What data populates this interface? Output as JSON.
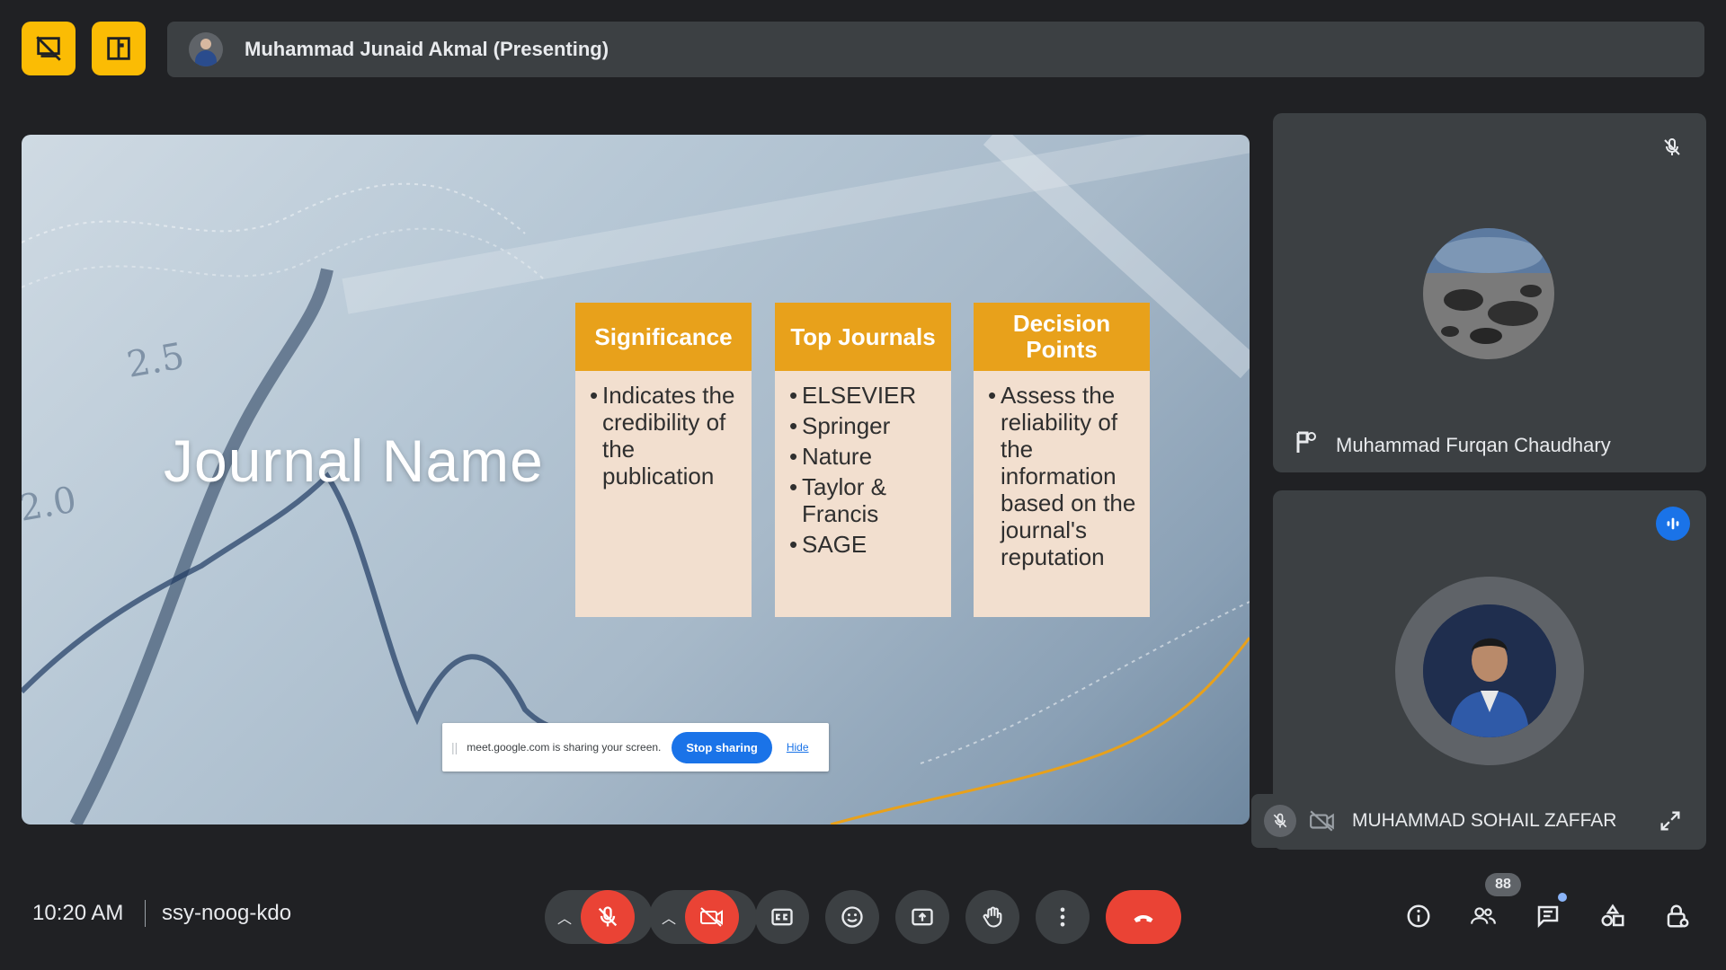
{
  "header": {
    "presenter_label": "Muhammad Junaid Akmal (Presenting)"
  },
  "slide": {
    "title": "Journal Name",
    "cards": [
      {
        "heading": "Significance",
        "bullets": [
          "Indicates the credibility of the publication"
        ]
      },
      {
        "heading": "Top Journals",
        "bullets": [
          "ELSEVIER",
          "Springer",
          "Nature",
          "Taylor & Francis",
          "SAGE"
        ]
      },
      {
        "heading": "Decision Points",
        "bullets": [
          "Assess the reliability of the information based on the journal's reputation"
        ]
      }
    ],
    "axis_labels": [
      "2.5",
      "2.0"
    ]
  },
  "share_banner": {
    "message": "meet.google.com is sharing your screen.",
    "stop_label": "Stop sharing",
    "hide_label": "Hide"
  },
  "participants": [
    {
      "name": "Muhammad Furqan Chaudhary",
      "muted": true
    },
    {
      "name": "MUHAMMAD SOHAIL ZAFFAR",
      "muted": true,
      "speaking": true
    }
  ],
  "footer": {
    "time": "10:20 AM",
    "meeting_code": "ssy-noog-kdo",
    "people_count": "88"
  },
  "colors": {
    "accent_yellow": "#fbbc04",
    "danger_red": "#ea4335",
    "primary_blue": "#1a73e8",
    "card_header": "#e8a11b",
    "card_body": "#f2dfcf"
  }
}
